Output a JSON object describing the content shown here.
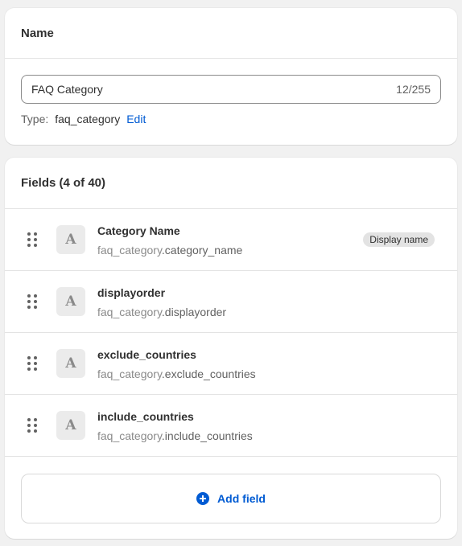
{
  "name_card": {
    "title": "Name",
    "input_value": "FAQ Category",
    "char_count": "12/255",
    "type_label": "Type:",
    "type_value": "faq_category",
    "edit_label": "Edit"
  },
  "fields_card": {
    "title": "Fields (4 of 40)",
    "fields": [
      {
        "title": "Category Name",
        "namespace": "faq_category",
        "key": ".category_name",
        "icon": "A",
        "badge": "Display name"
      },
      {
        "title": "displayorder",
        "namespace": "faq_category",
        "key": ".displayorder",
        "icon": "A"
      },
      {
        "title": "exclude_countries",
        "namespace": "faq_category",
        "key": ".exclude_countries",
        "icon": "A"
      },
      {
        "title": "include_countries",
        "namespace": "faq_category",
        "key": ".include_countries",
        "icon": "A"
      }
    ],
    "add_field_label": "Add field"
  },
  "colors": {
    "accent": "#005bd3",
    "background": "#f1f1f1",
    "card": "#ffffff",
    "badge_bg": "#e3e3e3"
  }
}
